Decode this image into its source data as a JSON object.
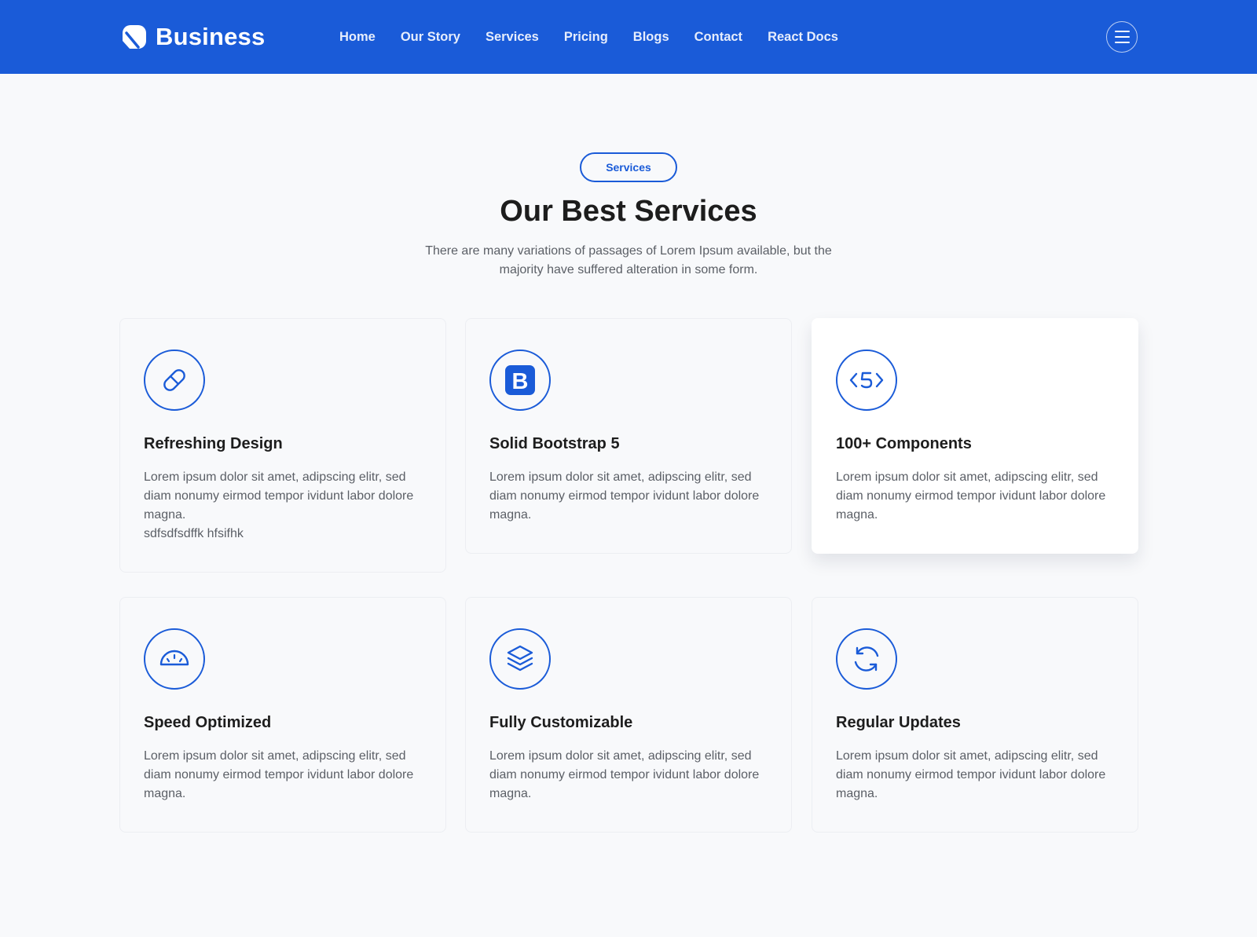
{
  "brand": {
    "name": "Business"
  },
  "nav": {
    "links": [
      "Home",
      "Our Story",
      "Services",
      "Pricing",
      "Blogs",
      "Contact",
      "React Docs"
    ],
    "menu_icon": "hamburger-icon"
  },
  "colors": {
    "primary": "#1a5bd8",
    "background": "#f8f9fb",
    "heading": "#1d1d1d",
    "body_text": "#5b5f66"
  },
  "section": {
    "badge": "Services",
    "title": "Our Best Services",
    "subtitle": "There are many variations of passages of Lorem Ipsum available, but the majority have suffered alteration in some form."
  },
  "services": [
    {
      "icon": "pill-icon",
      "title": "Refreshing Design",
      "text": "Lorem ipsum dolor sit amet, adipscing elitr, sed diam nonumy eirmod tempor ividunt labor dolore magna.",
      "extra": "sdfsdfsdffk hfsifhk"
    },
    {
      "icon": "bootstrap-icon",
      "title": "Solid Bootstrap 5",
      "text": "Lorem ipsum dolor sit amet, adipscing elitr, sed diam nonumy eirmod tempor ividunt labor dolore magna."
    },
    {
      "icon": "html5-code-icon",
      "title": "100+ Components",
      "text": "Lorem ipsum dolor sit amet, adipscing elitr, sed diam nonumy eirmod tempor ividunt labor dolore magna."
    },
    {
      "icon": "speedometer-icon",
      "title": "Speed Optimized",
      "text": "Lorem ipsum dolor sit amet, adipscing elitr, sed diam nonumy eirmod tempor ividunt labor dolore magna."
    },
    {
      "icon": "layers-icon",
      "title": "Fully Customizable",
      "text": "Lorem ipsum dolor sit amet, adipscing elitr, sed diam nonumy eirmod tempor ividunt labor dolore magna."
    },
    {
      "icon": "refresh-icon",
      "title": "Regular Updates",
      "text": "Lorem ipsum dolor sit amet, adipscing elitr, sed diam nonumy eirmod tempor ividunt labor dolore magna."
    }
  ]
}
